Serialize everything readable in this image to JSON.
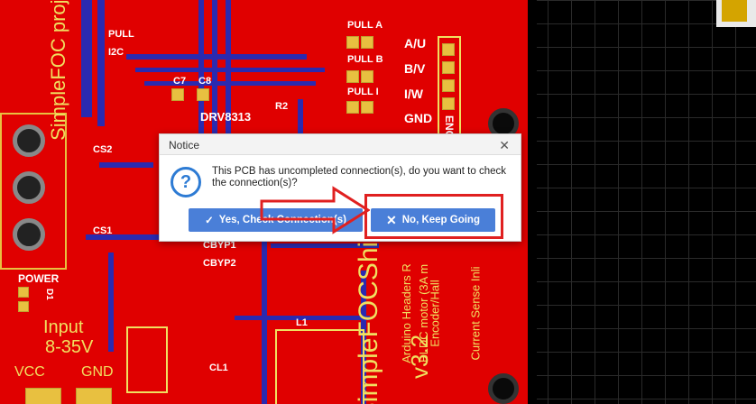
{
  "board_labels": {
    "simplefoc_project": "SimpleFOC project",
    "i2c": "I2C",
    "pull_up_r1": "PULL",
    "pull_a": "PULL A",
    "pull_b": "PULL B",
    "pull_i": "PULL I",
    "a_u": "A/U",
    "b_v": "B/V",
    "i_w": "I/W",
    "gnd_top": "GND",
    "enc": "ENC",
    "c7": "C7",
    "c8": "C8",
    "drv": "DRV8313",
    "r2": "R2",
    "cs2": "CS2",
    "cs1": "CS1",
    "cbyp1": "CBYP1",
    "cbyp2": "CBYP2",
    "power": "POWER",
    "d1": "D1",
    "input": "Input",
    "input_range": "8-35V",
    "vcc": "VCC",
    "gnd_bottom": "GND",
    "l1": "L1",
    "cl1": "CL1",
    "brand": "SimpleFOCShield",
    "version": "v3.2",
    "arduino": "Arduino Headers R",
    "bldc": "BLDC motor (3A m",
    "encoder": "Encoder/Hall",
    "current": "Current Sense Inli"
  },
  "dialog": {
    "title": "Notice",
    "message": "This PCB has uncompleted connection(s), do you want to check the connection(s)?",
    "yes_label": "Yes, Check Connection(s)",
    "no_label": "No, Keep Going"
  },
  "colors": {
    "board": "#e00000",
    "button": "#4a7fd8",
    "highlight": "#e02020",
    "info_icon": "#2d7bd4"
  }
}
